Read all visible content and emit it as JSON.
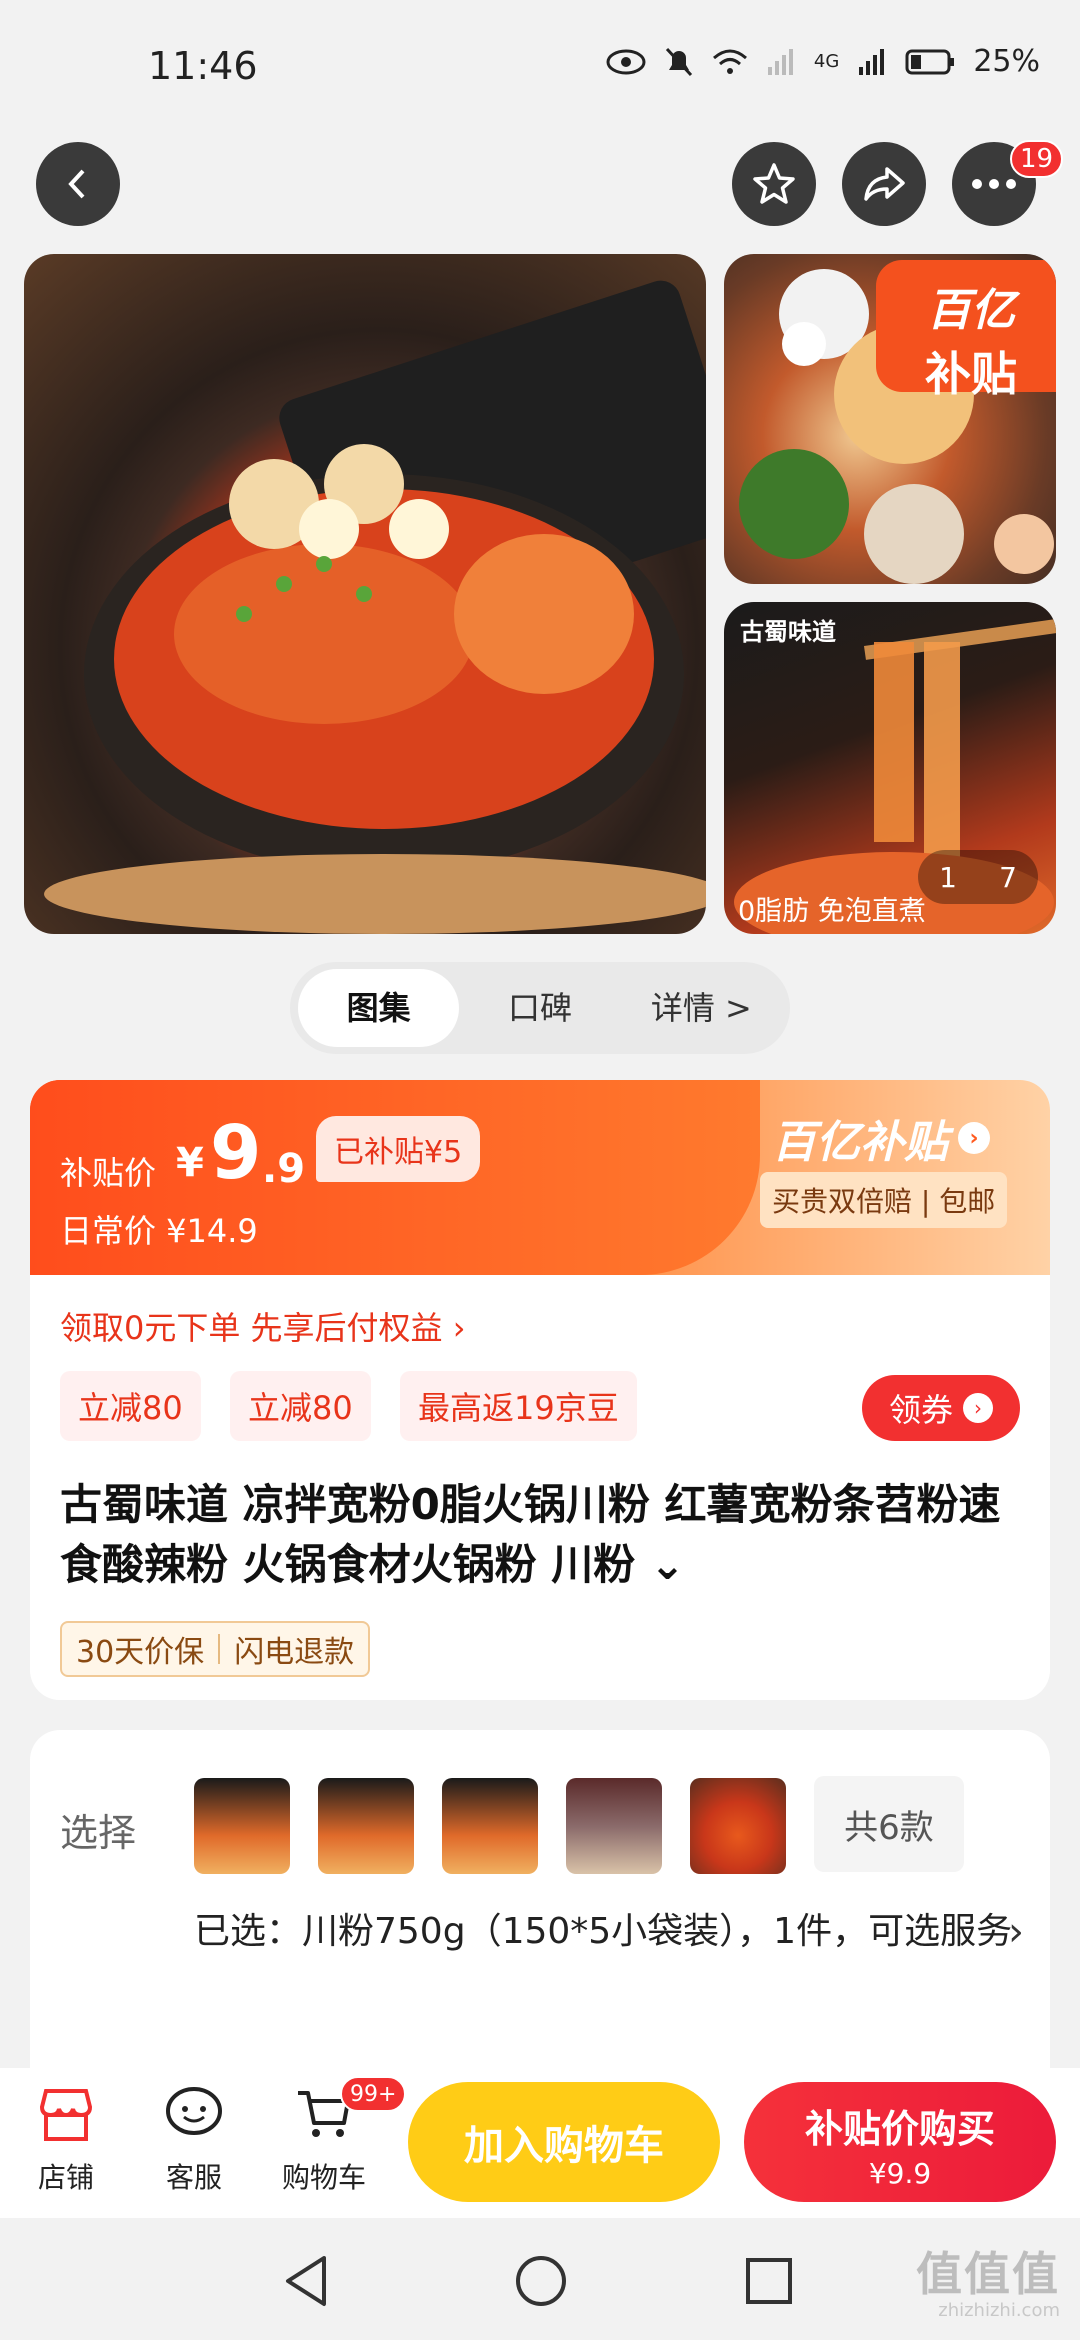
{
  "status_bar": {
    "time": "11:46",
    "battery": "25%",
    "network": "4G"
  },
  "top_bar": {
    "notification_count": "19"
  },
  "gallery": {
    "corner_badge_line1": "百亿",
    "corner_badge_line2": "补贴",
    "brand_text": "古蜀味道",
    "caption": "0脂肪  免泡直煮",
    "counter_current": "1",
    "counter_total": "7"
  },
  "tabs": [
    {
      "label": "图集"
    },
    {
      "label": "口碑"
    },
    {
      "label": "详情 >"
    }
  ],
  "price": {
    "subsidy_label": "补贴价",
    "yen": "¥",
    "value_int": "9",
    "value_dec": ".9",
    "subsidized_tag": "已补贴¥5",
    "daily_price": "日常价 ¥14.9",
    "brand_logo": "百亿补贴",
    "brand_arrow": "›",
    "guarantee": "买贵双倍赔 | 包邮"
  },
  "promo": {
    "line": "领取0元下单 先享后付权益 ›",
    "chips": [
      "立减80",
      "立减80",
      "最高返19京豆"
    ],
    "coupon_button": "领券",
    "coupon_arrow": "›"
  },
  "product": {
    "title": "古蜀味道 凉拌宽粉0脂火锅川粉 红薯宽粉条苕粉速食酸辣粉 火锅食材火锅粉 川粉 ⌄",
    "service_tag_1": "30天价保",
    "service_tag_2": "闪电退款"
  },
  "selection": {
    "label": "选择",
    "more_variants": "共6款",
    "selected_text": "已选：川粉750g（150*5小袋装），1件，可选服务",
    "chevron": "›"
  },
  "bottom_bar": {
    "store": "店铺",
    "service": "客服",
    "cart": "购物车",
    "cart_badge": "99+",
    "add_to_cart": "加入购物车",
    "buy_line1": "补贴价购买",
    "buy_line2": "¥9.9"
  },
  "watermark": {
    "text": "值值值",
    "sub": "zhizhizhi.com"
  },
  "colors": {
    "accent_red": "#f23030",
    "orange": "#ff5a1f",
    "yellow": "#ffcc16"
  }
}
